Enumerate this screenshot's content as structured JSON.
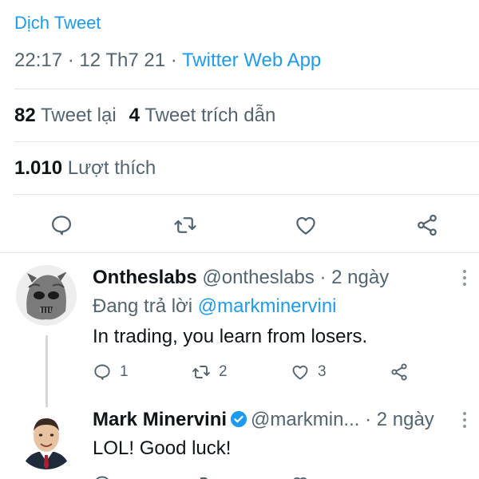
{
  "tweet_detail": {
    "translate_label": "Dịch Tweet",
    "time": "22:17",
    "sep1": " · ",
    "date": "12 Th7 21",
    "sep2": " · ",
    "source_app": "Twitter Web App",
    "retweets_count": "82",
    "retweets_label": "Tweet lại",
    "quotes_count": "4",
    "quotes_label": "Tweet trích dẫn",
    "likes_count": "1.010",
    "likes_label": "Lượt thích"
  },
  "action_icons": [
    "reply-icon",
    "retweet-icon",
    "like-icon",
    "share-icon"
  ],
  "replies": [
    {
      "name": "Ontheslabs",
      "handle": "@ontheslabs",
      "sep": " · ",
      "age": "2 ngày",
      "reply_prefix": "Đang trả lời",
      "reply_to": "@markminervini",
      "text": "In trading, you learn from losers.",
      "reply_count": "1",
      "retweet_count": "2",
      "like_count": "3"
    },
    {
      "name": "Mark Minervini",
      "verified": true,
      "handle": "@markmin...",
      "sep": " · ",
      "age": "2 ngày",
      "text": "LOL! Good luck!"
    }
  ],
  "colors": {
    "accent": "#1d9bf0",
    "secondary_text": "#536471",
    "divider": "#e1e4e8"
  }
}
